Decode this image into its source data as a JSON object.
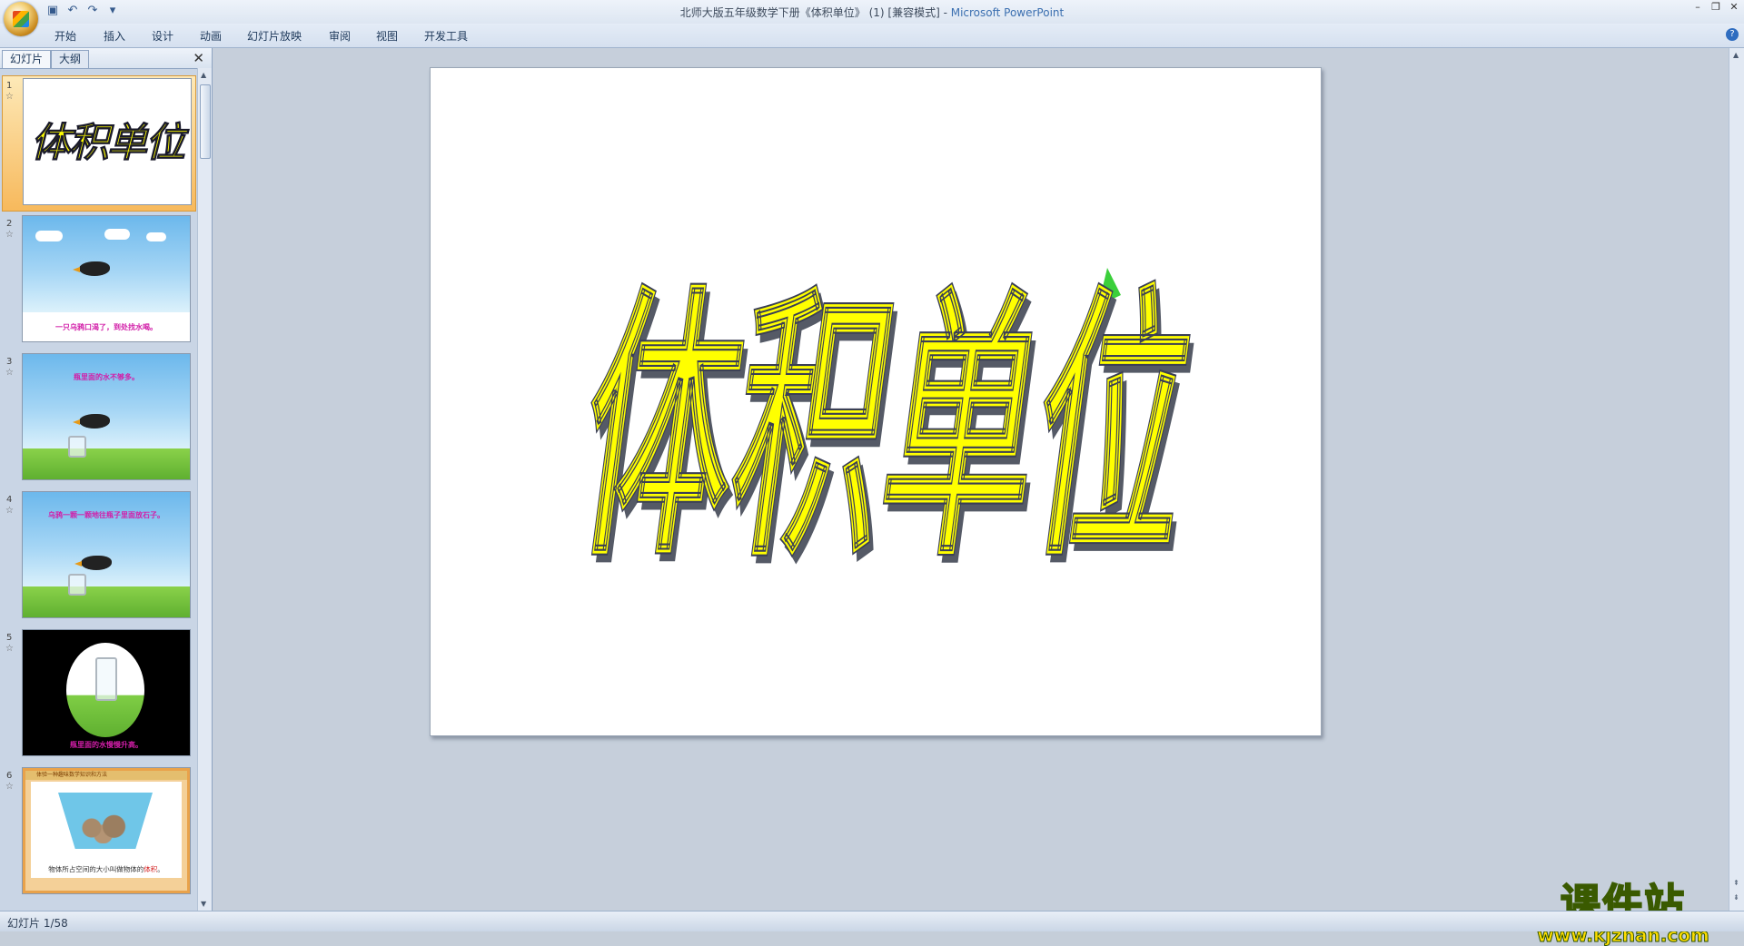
{
  "window": {
    "title_main": "北师大版五年级数学下册《体积单位》 (1) [兼容模式] - ",
    "title_app": "Microsoft PowerPoint"
  },
  "ribbon": {
    "tabs": [
      "开始",
      "插入",
      "设计",
      "动画",
      "幻灯片放映",
      "审阅",
      "视图",
      "开发工具"
    ]
  },
  "pane": {
    "tab_slides": "幻灯片",
    "tab_outline": "大纲"
  },
  "thumbnails": [
    {
      "num": "1",
      "title": "体积单位"
    },
    {
      "num": "2",
      "caption": "一只乌鸦口渴了，到处找水喝。"
    },
    {
      "num": "3",
      "caption": "瓶里面的水不够多。"
    },
    {
      "num": "4",
      "caption": "乌鸦一颗一颗地往瓶子里面放石子。"
    },
    {
      "num": "5",
      "caption": "瓶里面的水慢慢升高。"
    },
    {
      "num": "6",
      "header": "体验一种趣味数学知识和方法",
      "caption_pre": "物体所占空间的大小叫做物体的",
      "caption_hl": "体积",
      "caption_post": "。"
    }
  ],
  "slide": {
    "title": "体积单位",
    "title_color": "#FFFF00"
  },
  "status": {
    "text": "幻灯片 1/58"
  },
  "watermark": {
    "title": "课件站",
    "url": "www.kjzhan.com"
  }
}
